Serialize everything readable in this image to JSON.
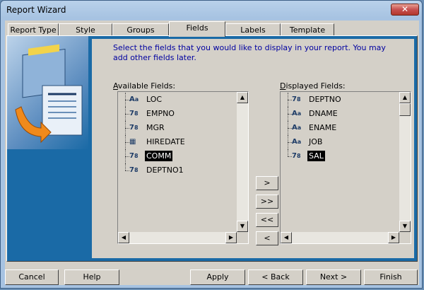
{
  "window": {
    "title": "Report Wizard",
    "close_glyph": "✕"
  },
  "tabs": [
    {
      "label": "Report Type"
    },
    {
      "label": "Style"
    },
    {
      "label": "Groups"
    },
    {
      "label": "Fields",
      "active": true
    },
    {
      "label": "Labels"
    },
    {
      "label": "Template"
    }
  ],
  "intro": "Select the fields that you would like to display in your report. You may add other fields later.",
  "available": {
    "label_prefix": "A",
    "label_rest": "vailable Fields:",
    "items": [
      {
        "name": "LOC",
        "type": "text-field-icon",
        "glyph": "A",
        "sub": "a"
      },
      {
        "name": "EMPNO",
        "type": "number-field-icon",
        "glyph": "7",
        "sub": "8"
      },
      {
        "name": "MGR",
        "type": "number-field-icon",
        "glyph": "7",
        "sub": "8"
      },
      {
        "name": "HIREDATE",
        "type": "date-field-icon",
        "glyph": "▦",
        "sub": ""
      },
      {
        "name": "COMM",
        "type": "number-field-icon",
        "glyph": "7",
        "sub": "8",
        "selected": true
      },
      {
        "name": "DEPTNO1",
        "type": "number-field-icon",
        "glyph": "7",
        "sub": "8"
      }
    ]
  },
  "displayed": {
    "label_prefix": "D",
    "label_rest": "isplayed Fields:",
    "items": [
      {
        "name": "DEPTNO",
        "type": "number-field-icon",
        "glyph": "7",
        "sub": "8"
      },
      {
        "name": "DNAME",
        "type": "text-field-icon",
        "glyph": "A",
        "sub": "a"
      },
      {
        "name": "ENAME",
        "type": "text-field-icon",
        "glyph": "A",
        "sub": "a"
      },
      {
        "name": "JOB",
        "type": "text-field-icon",
        "glyph": "A",
        "sub": "a"
      },
      {
        "name": "SAL",
        "type": "number-field-icon",
        "glyph": "7",
        "sub": "8",
        "selected": true
      }
    ]
  },
  "move_buttons": {
    "add": ">",
    "add_all": ">>",
    "remove_all": "<<",
    "remove": "<"
  },
  "scroll_glyphs": {
    "up": "▲",
    "down": "▼",
    "left": "◀",
    "right": "▶"
  },
  "footer": {
    "cancel": "Cancel",
    "help": "Help",
    "apply": "Apply",
    "back": "< Back",
    "next": "Next >",
    "finish": "Finish"
  }
}
